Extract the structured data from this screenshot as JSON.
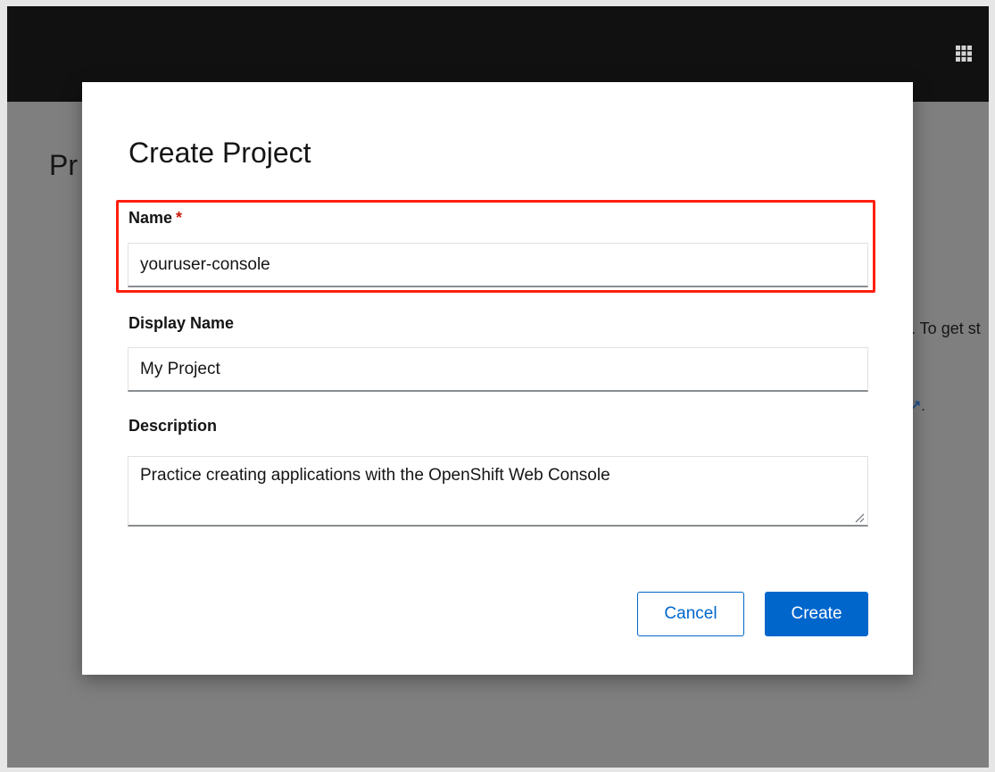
{
  "background": {
    "heading_fragment": "Pr",
    "text_fragment": ". To get st",
    "link_fragment": "."
  },
  "icons": {
    "app_launcher": "grid-icon",
    "external_link": "external-link-icon",
    "resize": "resize-handle-icon"
  },
  "colors": {
    "masthead": "#111111",
    "primary": "#0066cc",
    "required": "#c9190b",
    "highlight": "#ff1f0f"
  },
  "modal": {
    "title": "Create Project",
    "fields": {
      "name": {
        "label": "Name",
        "required_marker": "*",
        "value": "youruser-console"
      },
      "display_name": {
        "label": "Display Name",
        "value": "My Project"
      },
      "description": {
        "label": "Description",
        "value": "Practice creating applications with the OpenShift Web Console"
      }
    },
    "buttons": {
      "cancel": "Cancel",
      "create": "Create"
    }
  }
}
